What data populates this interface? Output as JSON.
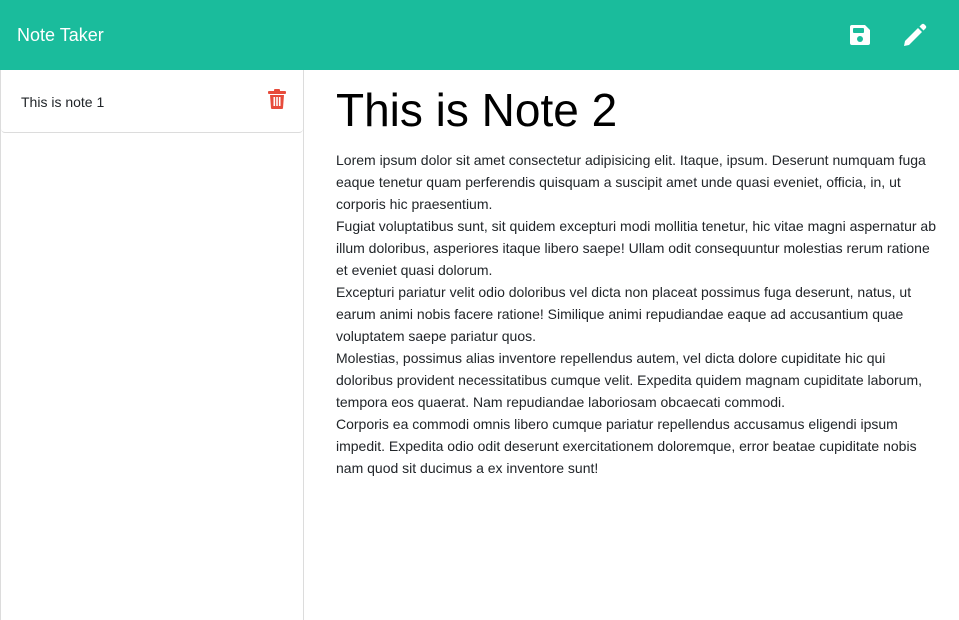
{
  "header": {
    "title": "Note Taker",
    "save_icon": "floppy-disk-icon",
    "edit_icon": "pencil-icon",
    "color": "#1abc9c"
  },
  "sidebar": {
    "notes": [
      {
        "title": "This is note 1",
        "delete_icon": "trash-icon",
        "delete_color": "#e74c3c"
      }
    ]
  },
  "editor": {
    "title": "This is Note 2",
    "paragraphs": [
      "Lorem ipsum dolor sit amet consectetur adipisicing elit. Itaque, ipsum. Deserunt numquam fuga eaque tenetur quam perferendis quisquam a suscipit amet unde quasi eveniet, officia, in, ut corporis hic praesentium.",
      "Fugiat voluptatibus sunt, sit quidem excepturi modi mollitia tenetur, hic vitae magni aspernatur ab illum doloribus, asperiores itaque libero saepe! Ullam odit consequuntur molestias rerum ratione et eveniet quasi dolorum.",
      "Excepturi pariatur velit odio doloribus vel dicta non placeat possimus fuga deserunt, natus, ut earum animi nobis facere ratione! Similique animi repudiandae eaque ad accusantium quae voluptatem saepe pariatur quos.",
      "Molestias, possimus alias inventore repellendus autem, vel dicta dolore cupiditate hic qui doloribus provident necessitatibus cumque velit. Expedita quidem magnam cupiditate laborum, tempora eos quaerat. Nam repudiandae laboriosam obcaecati commodi.",
      "Corporis ea commodi omnis libero cumque pariatur repellendus accusamus eligendi ipsum impedit. Expedita odio odit deserunt exercitationem doloremque, error beatae cupiditate nobis nam quod sit ducimus a ex inventore sunt!"
    ]
  }
}
